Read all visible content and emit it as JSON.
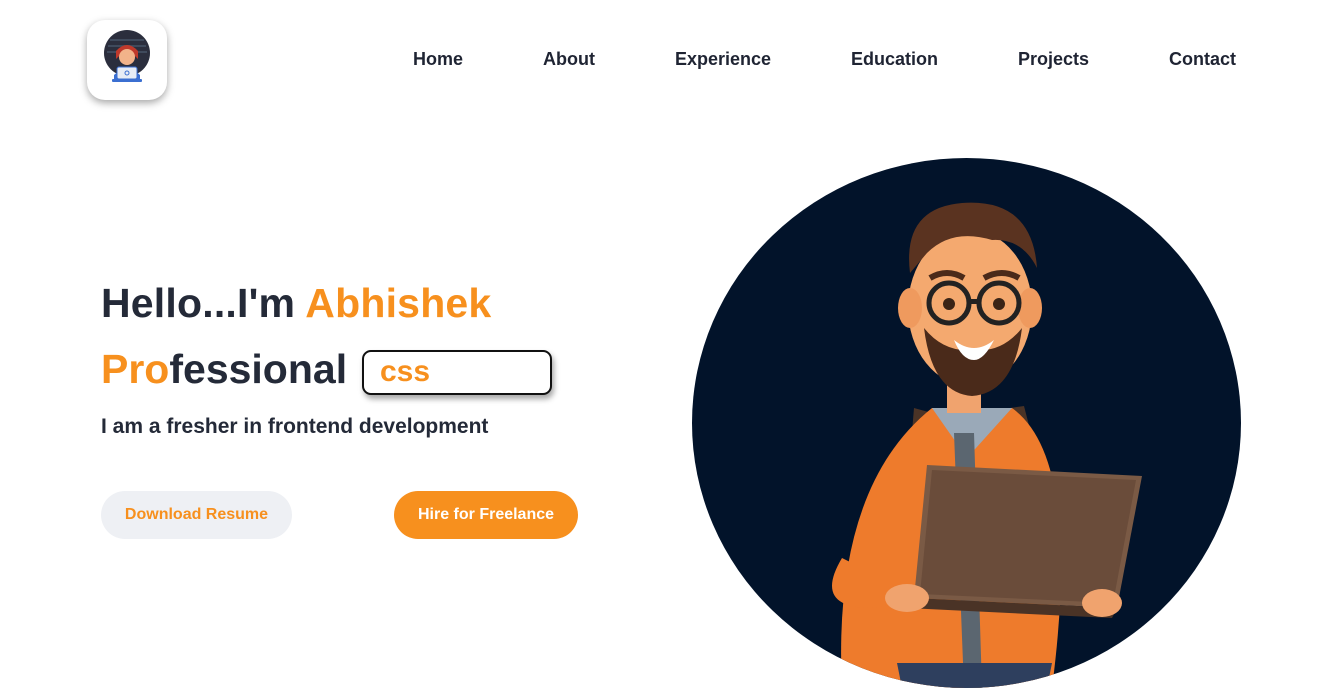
{
  "logo": {
    "icon": "developer-avatar-icon"
  },
  "nav": {
    "items": [
      {
        "label": "Home"
      },
      {
        "label": "About"
      },
      {
        "label": "Experience"
      },
      {
        "label": "Education"
      },
      {
        "label": "Projects"
      },
      {
        "label": "Contact"
      }
    ]
  },
  "hero": {
    "greeting": "Hello...I'm",
    "name": "Abhishek",
    "role_accent": "Pro",
    "role_rest": "fessional",
    "typed_text": "css",
    "subtitle": "I am a fresher in frontend development",
    "buttons": {
      "resume": "Download Resume",
      "hire": "Hire for Freelance"
    },
    "illustration": "developer-with-laptop-illustration"
  },
  "colors": {
    "accent": "#f7901e",
    "text": "#242a38",
    "circle_bg": "#02132a",
    "secondary_button_bg": "#eef0f4"
  }
}
